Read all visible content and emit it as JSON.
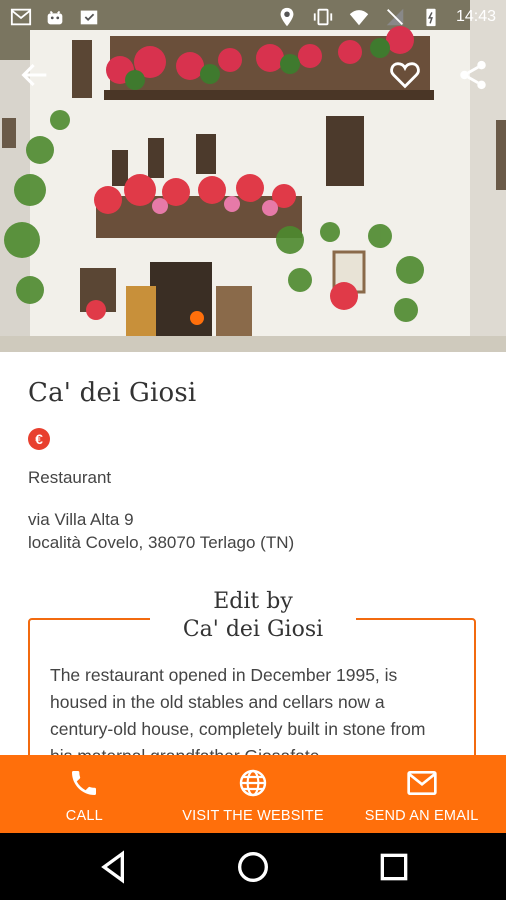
{
  "status_bar": {
    "time": "14:43"
  },
  "place": {
    "name": "Ca' dei Giosi",
    "price_symbol": "€",
    "category": "Restaurant",
    "address_line1": "via Villa Alta 9",
    "address_line2": "località Covelo, 38070 Terlago (TN)"
  },
  "edit": {
    "heading_line1": "Edit by",
    "heading_line2": "Ca' dei Giosi",
    "text": "The restaurant opened in December 1995, is housed in the old stables and cellars now a century-old house, completely built in stone from his maternal grandfather Giosafate..."
  },
  "actions": {
    "call": "CALL",
    "website": "VISIT THE WEBSITE",
    "email": "SEND AN EMAIL"
  },
  "colors": {
    "accent": "#ff6f0b",
    "price_badge": "#e8402f"
  }
}
